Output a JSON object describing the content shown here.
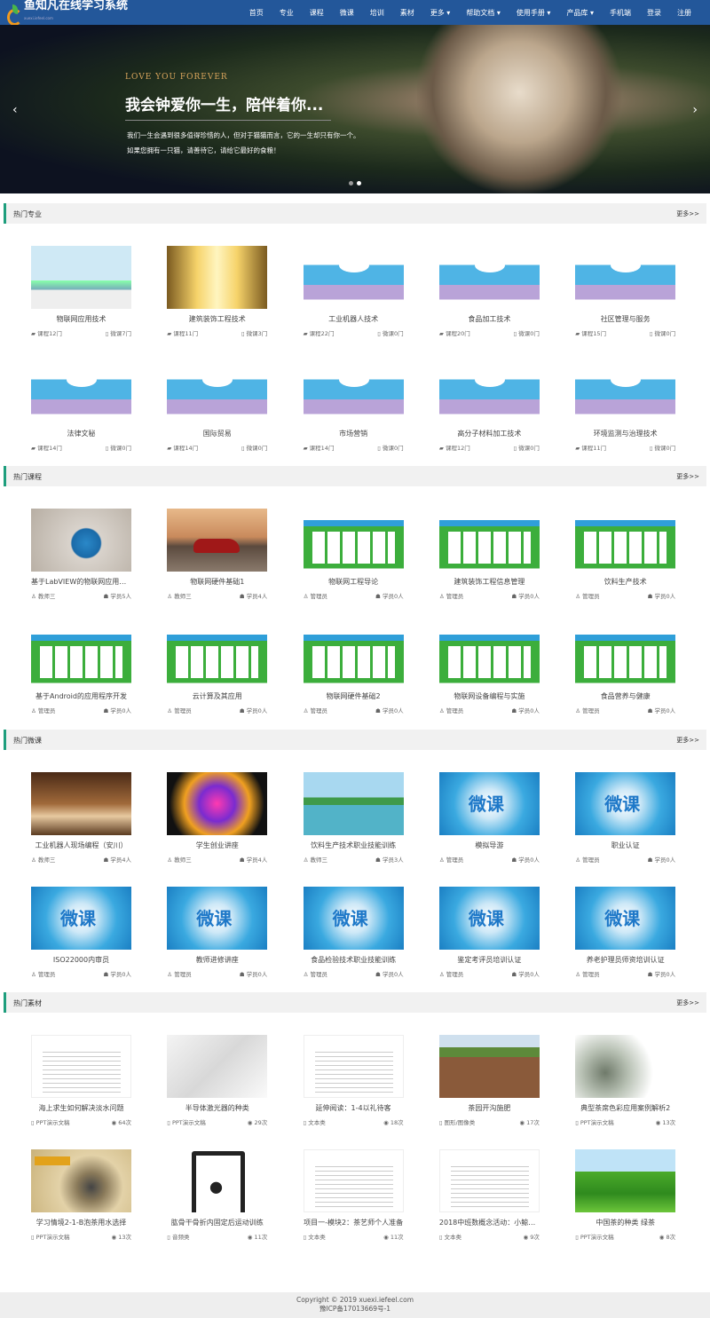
{
  "header": {
    "logo": "鱼知凡在线学习系统",
    "logo_sub": "xuexi.iefeel.com",
    "nav": [
      "首页",
      "专业",
      "课程",
      "微课",
      "培训",
      "素材",
      "更多 ▾",
      "帮助文档 ▾",
      "使用手册 ▾",
      "产品库 ▾",
      "手机端",
      "登录",
      "注册"
    ]
  },
  "banner": {
    "en": "LOVE YOU FOREVER",
    "title": "我会钟爱你一生，陪伴着你...",
    "p1": "我们一生会遇到很多值得珍惜的人，但对于猫猫而言，它的一生却只有你一个。",
    "p2": "如果您拥有一只猫，请善待它，请给它最好的食粮！",
    "prev": "‹",
    "next": "›"
  },
  "sections": [
    {
      "title": "热门专业",
      "more": "更多>>",
      "items": [
        {
          "img": "city",
          "title": "物联网应用技术",
          "left": "课程12门",
          "right": "微课7门"
        },
        {
          "img": "hall",
          "title": "建筑装饰工程技术",
          "left": "课程11门",
          "right": "微课3门"
        },
        {
          "img": "school",
          "title": "工业机器人技术",
          "left": "课程22门",
          "right": "微课0门"
        },
        {
          "img": "school",
          "title": "食品加工技术",
          "left": "课程20门",
          "right": "微课0门"
        },
        {
          "img": "school",
          "title": "社区管理与服务",
          "left": "课程15门",
          "right": "微课0门"
        },
        {
          "img": "school",
          "title": "法律文秘",
          "left": "课程14门",
          "right": "微课0门"
        },
        {
          "img": "school",
          "title": "国际贸易",
          "left": "课程14门",
          "right": "微课0门"
        },
        {
          "img": "school",
          "title": "市场营销",
          "left": "课程14门",
          "right": "微课0门"
        },
        {
          "img": "school",
          "title": "高分子材料加工技术",
          "left": "课程12门",
          "right": "微课0门"
        },
        {
          "img": "school",
          "title": "环境监测与治理技术",
          "left": "课程11门",
          "right": "微课0门"
        }
      ]
    },
    {
      "title": "热门课程",
      "more": "更多>>",
      "items": [
        {
          "img": "cup",
          "title": "基于LabVIEW的物联网应用程...",
          "left": "教师三",
          "right": "学员5人"
        },
        {
          "img": "car",
          "title": "物联网硬件基础1",
          "left": "教师三",
          "right": "学员4人"
        },
        {
          "img": "board",
          "title": "物联网工程导论",
          "left": "管理员",
          "right": "学员0人"
        },
        {
          "img": "board",
          "title": "建筑装饰工程信息管理",
          "left": "管理员",
          "right": "学员0人"
        },
        {
          "img": "board",
          "title": "饮料生产技术",
          "left": "管理员",
          "right": "学员0人"
        },
        {
          "img": "board",
          "title": "基于Android的应用程序开发",
          "left": "管理员",
          "right": "学员0人"
        },
        {
          "img": "board",
          "title": "云计算及其应用",
          "left": "管理员",
          "right": "学员0人"
        },
        {
          "img": "board",
          "title": "物联网硬件基础2",
          "left": "管理员",
          "right": "学员0人"
        },
        {
          "img": "board",
          "title": "物联网设备编程与实施",
          "left": "管理员",
          "right": "学员0人"
        },
        {
          "img": "board",
          "title": "食品营养与健康",
          "left": "管理员",
          "right": "学员0人"
        }
      ]
    },
    {
      "title": "热门微课",
      "more": "更多>>",
      "items": [
        {
          "img": "kitchen",
          "title": "工业机器人现场编程（安川）",
          "left": "教师三",
          "right": "学员4人"
        },
        {
          "img": "art",
          "title": "学生创业讲座",
          "left": "教师三",
          "right": "学员4人"
        },
        {
          "img": "lake",
          "title": "饮料生产技术职业技能训练",
          "left": "教师三",
          "right": "学员3人"
        },
        {
          "img": "wk",
          "title": "模拟导游",
          "left": "管理员",
          "right": "学员0人"
        },
        {
          "img": "wk",
          "title": "职业认证",
          "left": "管理员",
          "right": "学员0人"
        },
        {
          "img": "wk",
          "title": "ISO22000内审员",
          "left": "管理员",
          "right": "学员0人"
        },
        {
          "img": "wk",
          "title": "教师进修讲座",
          "left": "管理员",
          "right": "学员0人"
        },
        {
          "img": "wk",
          "title": "食品检验技术职业技能训练",
          "left": "管理员",
          "right": "学员0人"
        },
        {
          "img": "wk",
          "title": "鉴定考评员培训认证",
          "left": "管理员",
          "right": "学员0人"
        },
        {
          "img": "wk",
          "title": "养老护理员师资培训认证",
          "left": "管理员",
          "right": "学员0人"
        }
      ]
    },
    {
      "title": "热门素材",
      "more": "更多>>",
      "items": [
        {
          "img": "doc",
          "title": "海上求生如何解决淡水问题",
          "left": "PPT演示文稿",
          "right": "64次"
        },
        {
          "img": "stair",
          "title": "半导体激光器的种类",
          "left": "PPT演示文稿",
          "right": "29次"
        },
        {
          "img": "doc",
          "title": "延伸阅读：1-4以礼待客",
          "left": "文本类",
          "right": "18次"
        },
        {
          "img": "field",
          "title": "茶园开沟施肥",
          "left": "图形/图像类",
          "right": "17次"
        },
        {
          "img": "ink",
          "title": "典型茶席色彩应用案例解析2",
          "left": "PPT演示文稿",
          "right": "13次"
        },
        {
          "img": "tea",
          "title": "学习情境2-1-B泡茶用水选择",
          "left": "PPT演示文稿",
          "right": "13次"
        },
        {
          "img": "audio",
          "title": "肱骨干骨折内固定后运动训练",
          "left": "音频类",
          "right": "11次"
        },
        {
          "img": "doc",
          "title": "项目一-模块2：茶艺师个人准备",
          "left": "文本类",
          "right": "11次"
        },
        {
          "img": "doc",
          "title": "2018中班数概念活动：小鲸钟...",
          "left": "文本类",
          "right": "9次"
        },
        {
          "img": "green",
          "title": "中国茶的种类 绿茶",
          "left": "PPT演示文稿",
          "right": "8次"
        }
      ]
    }
  ],
  "footer": {
    "copyright": "Copyright © 2019 xuexi.iefeel.com",
    "icp": "豫ICP备17013669号-1"
  }
}
